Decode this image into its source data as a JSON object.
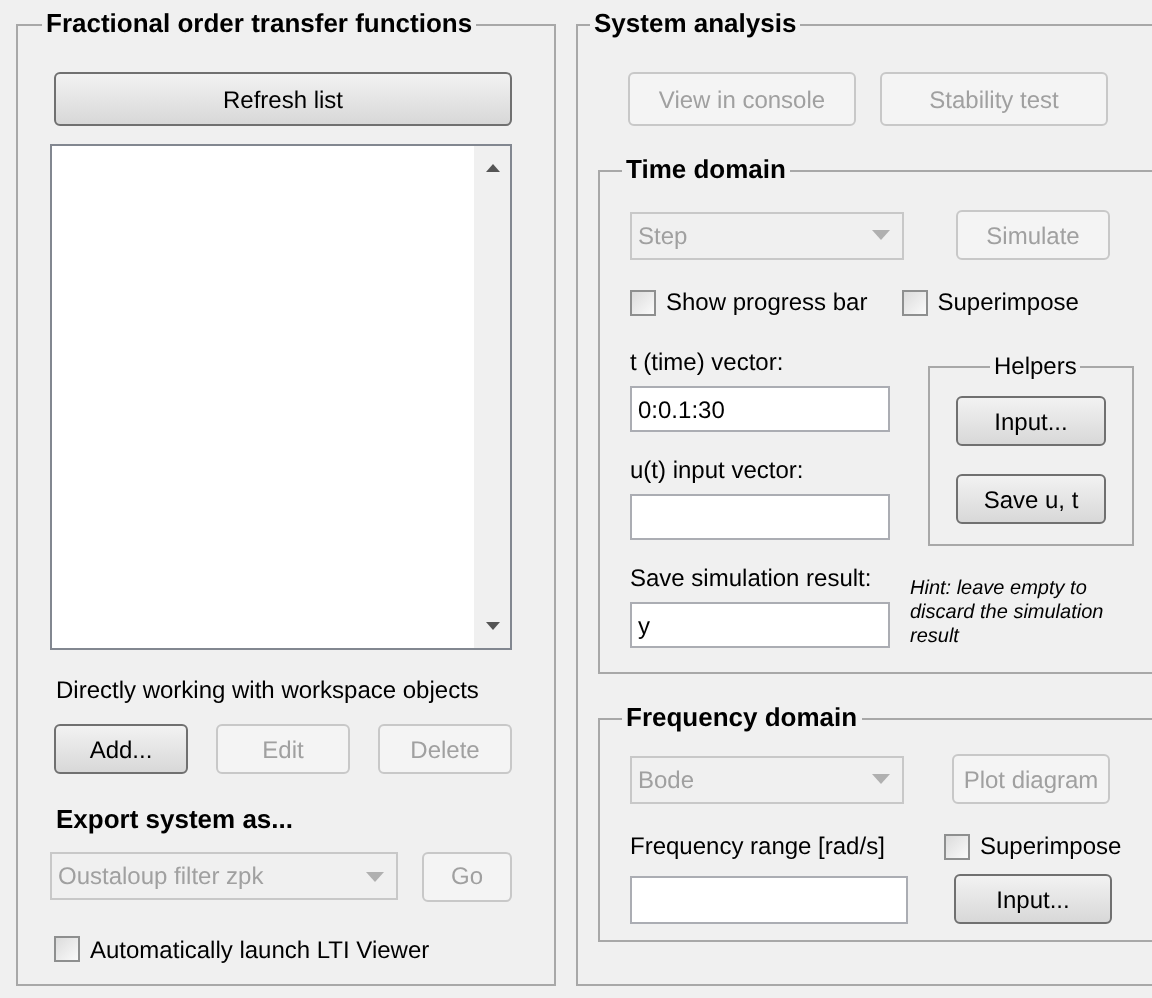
{
  "transfer_functions": {
    "title": "Fractional order transfer functions",
    "refresh_button": {
      "label": "Refresh list",
      "disabled": false
    },
    "workspace_label": "Directly working with workspace objects",
    "workspace_buttons": [
      {
        "label": "Add...",
        "disabled": false
      },
      {
        "label": "Edit",
        "disabled": true
      },
      {
        "label": "Delete",
        "disabled": true
      }
    ],
    "export_title": "Export system as...",
    "export_dropdown": {
      "value": "Oustaloup filter zpk",
      "disabled": true
    },
    "go_button": {
      "label": "Go",
      "disabled": true
    },
    "auto_launch": {
      "label": "Automatically launch LTI Viewer",
      "checked": false
    }
  },
  "system_analysis": {
    "title": "System analysis",
    "buttons": [
      {
        "label": "View in console",
        "disabled": true
      },
      {
        "label": "Stability test",
        "disabled": true
      }
    ],
    "time_domain": {
      "title": "Time domain",
      "dropdown": {
        "value": "Step",
        "disabled": true
      },
      "simulate_button": {
        "label": "Simulate",
        "disabled": true
      },
      "checkboxes": [
        {
          "label": "Show progress bar",
          "checked": false
        },
        {
          "label": "Superimpose",
          "checked": false
        }
      ],
      "fields": [
        {
          "label": "t (time) vector:",
          "value": "0:0.1:30"
        },
        {
          "label": "u(t) input vector:"
        },
        {
          "label": "Save simulation result:",
          "value": "y"
        }
      ],
      "helpers": {
        "title": "Helpers",
        "buttons": [
          {
            "label": "Input...",
            "disabled": false
          },
          {
            "label": "Save u, t",
            "disabled": false
          }
        ]
      },
      "hint": "Hint: leave empty to discard the simulation result"
    },
    "frequency_domain": {
      "title": "Frequency domain",
      "dropdown": {
        "value": "Bode",
        "disabled": true
      },
      "plot_button": {
        "label": "Plot diagram",
        "disabled": true
      },
      "range_label": "Frequency range [rad/s]",
      "superimpose": {
        "label": "Superimpose",
        "checked": false
      },
      "input_button": {
        "label": "Input...",
        "disabled": false
      }
    }
  }
}
